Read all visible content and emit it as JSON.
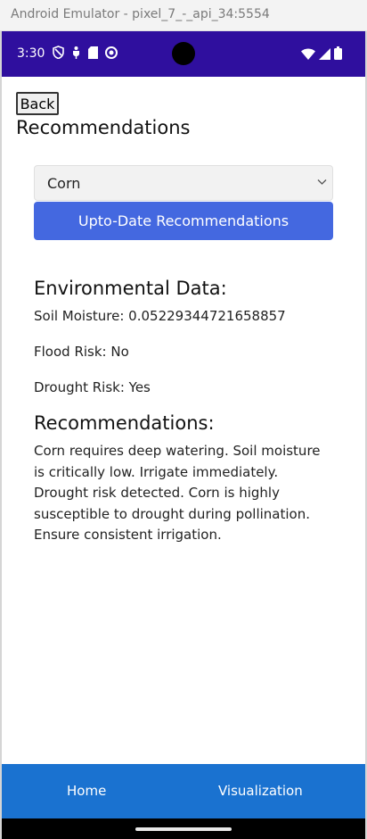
{
  "window": {
    "title": "Android Emulator - pixel_7_-_api_34:5554"
  },
  "status_bar": {
    "time": "3:30",
    "left_icons": [
      "privacy-shield-icon",
      "usb-debug-icon",
      "sd-card-icon",
      "app-notification-icon"
    ],
    "right_icons": [
      "wifi-icon",
      "cell-signal-icon",
      "battery-icon"
    ],
    "background": "#2f0f9e"
  },
  "app": {
    "back_label": "Back",
    "title": "Recommendations",
    "crop_select": {
      "value": "Corn"
    },
    "update_button_label": "Upto-Date Recommendations",
    "accent": "#4468e0"
  },
  "environment": {
    "heading": "Environmental Data:",
    "soil_moisture": "Soil Moisture: 0.05229344721658857",
    "flood_risk": "Flood Risk: No",
    "drought_risk": "Drought Risk: Yes"
  },
  "recommendations": {
    "heading": "Recommendations:",
    "text": "Corn requires deep watering. Soil moisture is critically low. Irrigate immediately. Drought risk detected. Corn is highly susceptible to drought during pollination. Ensure consistent irrigation."
  },
  "bottom_nav": {
    "home_label": "Home",
    "visualization_label": "Visualization",
    "background": "#1a72d0"
  }
}
